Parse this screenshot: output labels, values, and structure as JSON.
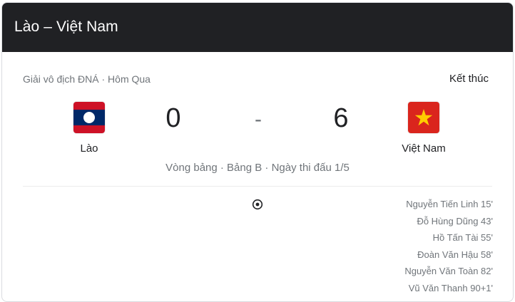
{
  "header": {
    "title": "Lào – Việt Nam"
  },
  "match": {
    "competition": "Giải vô địch ĐNÁ",
    "date": "Hôm Qua",
    "status": "Kết thúc",
    "round_info": "Vòng bảng · Bảng B · Ngày thi đấu 1/5",
    "home_team": {
      "name": "Lào",
      "score": "0",
      "flag_icon": "laos-flag-icon"
    },
    "away_team": {
      "name": "Việt Nam",
      "score": "6",
      "flag_icon": "vietnam-flag-icon"
    },
    "score_separator": "-"
  },
  "goals_icon": "soccer-ball-icon",
  "away_scorers": [
    "Nguyễn Tiến Linh 15'",
    "Đỗ Hùng Dũng 43'",
    "Hồ Tấn Tài 55'",
    "Đoàn Văn Hậu 58'",
    "Nguyễn Văn Toàn 82'",
    "Vũ Văn Thanh 90+1'"
  ],
  "colors": {
    "header_bg": "#202124",
    "laos_red": "#ce1126",
    "laos_blue": "#002868",
    "vietnam_red": "#da251d",
    "vietnam_star": "#ffcd00"
  }
}
